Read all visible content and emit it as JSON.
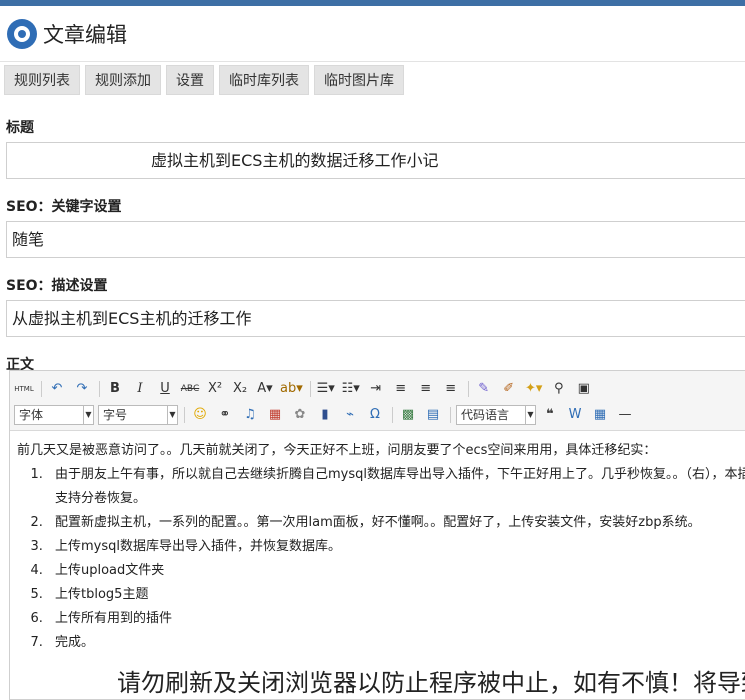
{
  "app": {
    "title": "文章编辑"
  },
  "tabs": [
    "规则列表",
    "规则添加",
    "设置",
    "临时库列表",
    "临时图片库"
  ],
  "form": {
    "title_label": "标题",
    "title_value": "虚拟主机到ECS主机的数据迁移工作小记",
    "seo_keywords_label": "SEO：关键字设置",
    "seo_keywords_value": "随笔",
    "seo_desc_label": "SEO：描述设置",
    "seo_desc_value": "从虚拟主机到ECS主机的迁移工作",
    "body_label": "正文"
  },
  "toolbar": {
    "html_btn": "HTML",
    "font_select": "字体",
    "size_select": "字号",
    "code_select": "代码语言"
  },
  "content": {
    "intro": "前几天又是被恶意访问了。。几天前就关闭了，今天正好不上班，问朋友要了个ecs空间来用用，具体迁移纪实：",
    "items": [
      "由于朋友上午有事，所以就自己去继续折腾自己mysql数据库导出导入插件，下午正好用上了。几乎秒恢复。。（右），本插件支持分卷恢复。",
      "配置新虚拟主机，一系列的配置。。第一次用lam面板，好不懂啊。。配置好了，上传安装文件，安装好zbp系统。",
      "上传mysql数据库导出导入插件，并恢复数据库。",
      "上传upload文件夹",
      "上传tblog5主题",
      "上传所有用到的插件",
      "完成。"
    ],
    "banner": "请勿刷新及关闭浏览器以防止程序被中止，如有不慎！将导致"
  }
}
